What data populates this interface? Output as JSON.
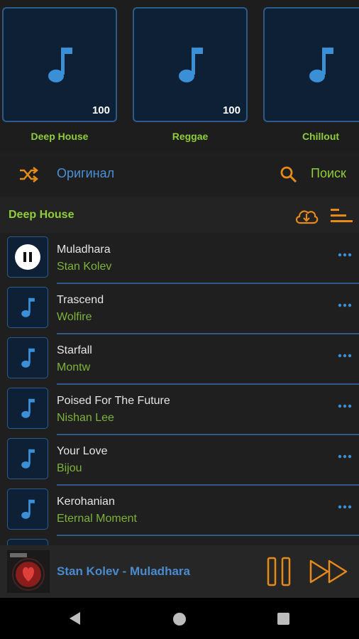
{
  "genres": [
    {
      "label": "Deep House",
      "count": "100"
    },
    {
      "label": "Reggae",
      "count": "100"
    },
    {
      "label": "Chillout",
      "count": ""
    }
  ],
  "controls": {
    "original_label": "Оригинал",
    "search_label": "Поиск"
  },
  "section": {
    "title": "Deep House"
  },
  "tracks": [
    {
      "title": "Muladhara",
      "artist": "Stan Kolev"
    },
    {
      "title": "Trascend",
      "artist": "Wolfire"
    },
    {
      "title": "Starfall",
      "artist": "Montw"
    },
    {
      "title": "Poised For The Future",
      "artist": "Nishan Lee"
    },
    {
      "title": "Your Love",
      "artist": "Bijou"
    },
    {
      "title": "Kerohanian",
      "artist": "Eternal Moment"
    }
  ],
  "player": {
    "now_playing": "Stan Kolev - Muladhara"
  },
  "colors": {
    "accent_blue": "#4a90d9",
    "accent_green": "#8fce3a",
    "accent_orange": "#e68a1a"
  }
}
